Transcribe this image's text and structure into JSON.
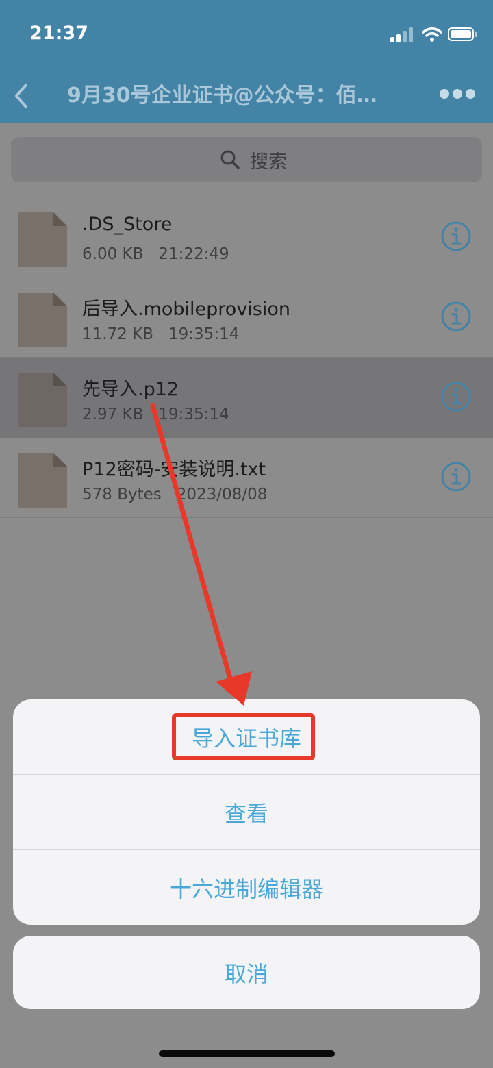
{
  "status_bar": {
    "time": "21:37"
  },
  "nav": {
    "title": "9月30号企业证书@公众号：佰…"
  },
  "search": {
    "placeholder": "搜索"
  },
  "files": [
    {
      "name": ".DS_Store",
      "size": "6.00 KB",
      "time": "21:22:49",
      "selected": false
    },
    {
      "name": "后导入.mobileprovision",
      "size": "11.72 KB",
      "time": "19:35:14",
      "selected": false
    },
    {
      "name": "先导入.p12",
      "size": "2.97 KB",
      "time": "19:35:14",
      "selected": true
    },
    {
      "name": "P12密码-安装说明.txt",
      "size": "578 Bytes",
      "time": "2023/08/08",
      "selected": false
    }
  ],
  "action_sheet": {
    "items": [
      {
        "label": "导入证书库",
        "highlighted": true
      },
      {
        "label": "查看",
        "highlighted": false
      },
      {
        "label": "十六进制编辑器",
        "highlighted": false
      }
    ],
    "cancel_label": "取消"
  },
  "colors": {
    "header": "#4383a6",
    "action_text": "#4aa8d8",
    "annotation_red": "#e8382a"
  }
}
